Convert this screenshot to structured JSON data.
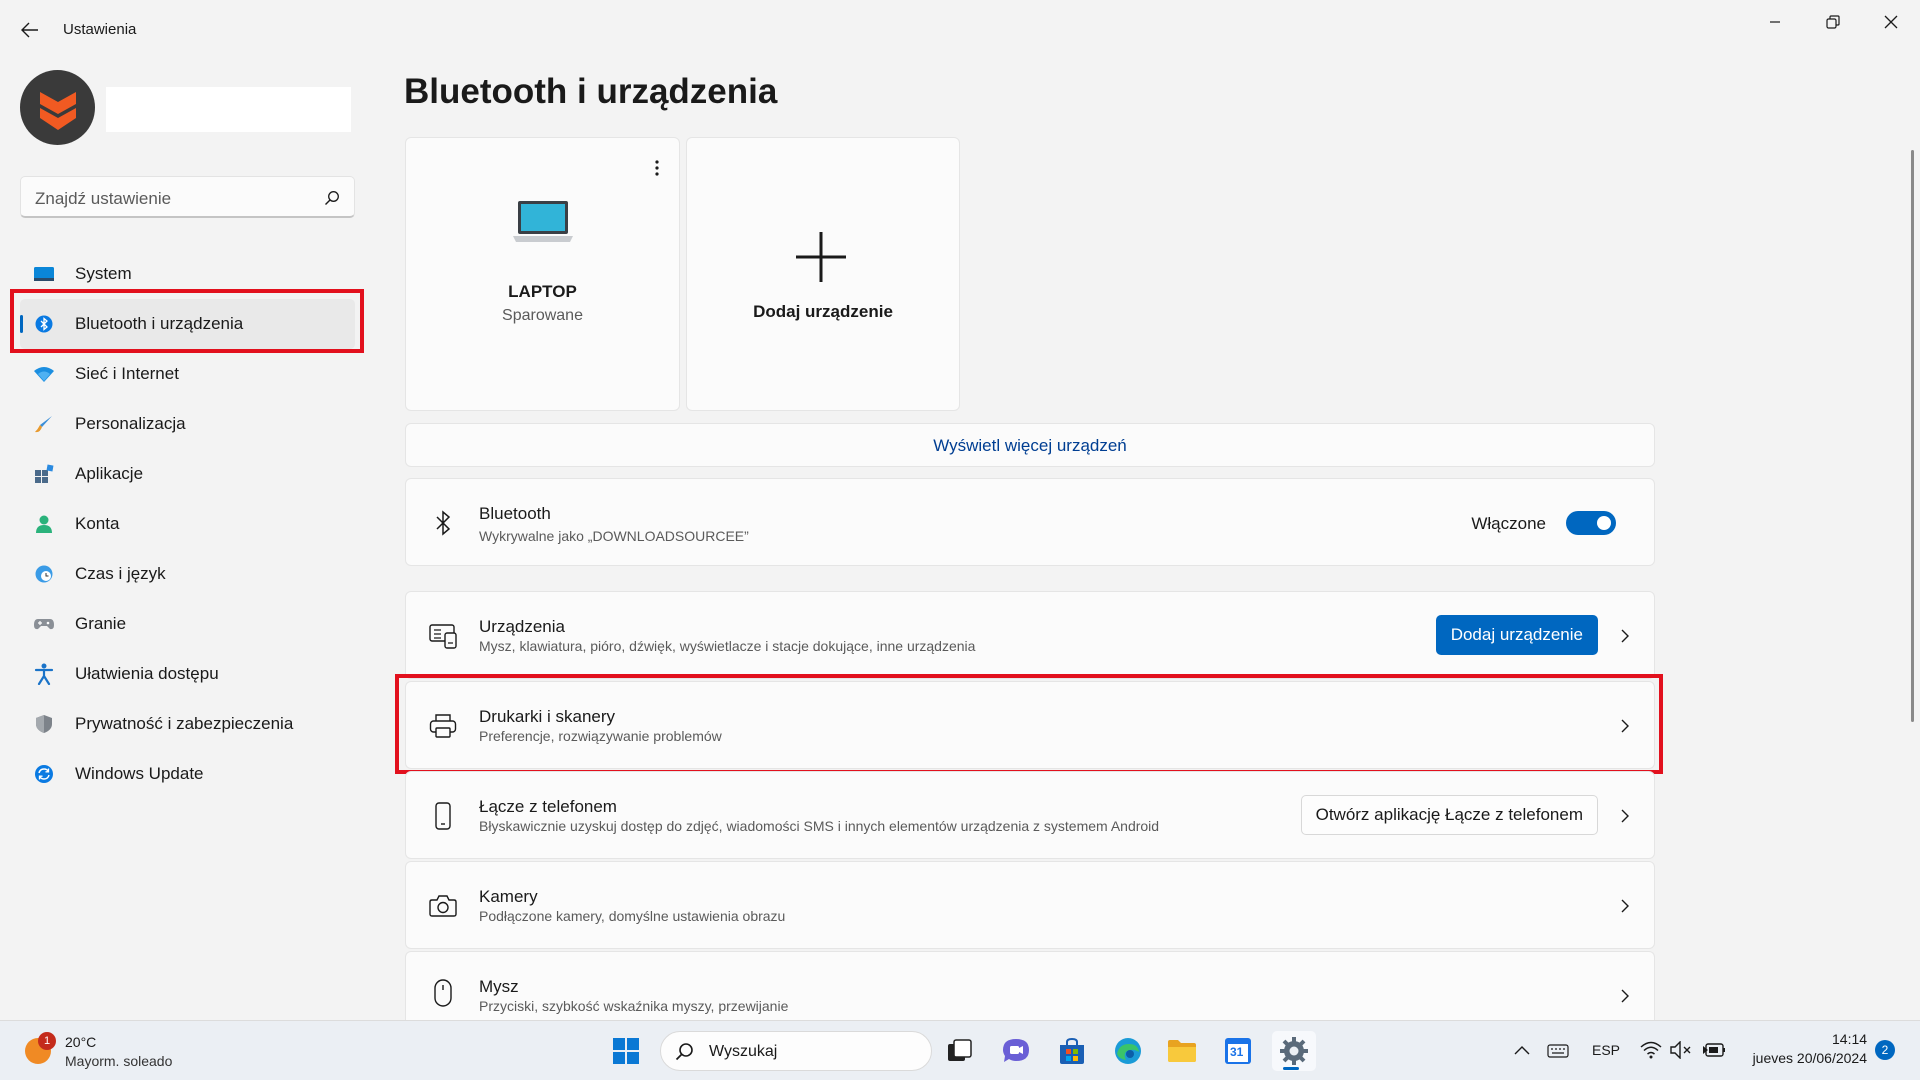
{
  "app": {
    "title": "Ustawienia"
  },
  "search": {
    "placeholder": "Znajdź ustawienie"
  },
  "sidebar": {
    "items": [
      {
        "label": "System",
        "icon": "monitor-icon"
      },
      {
        "label": "Bluetooth i urządzenia",
        "icon": "bluetooth-icon",
        "active": true
      },
      {
        "label": "Sieć i Internet",
        "icon": "wifi-icon"
      },
      {
        "label": "Personalizacja",
        "icon": "brush-icon"
      },
      {
        "label": "Aplikacje",
        "icon": "apps-icon"
      },
      {
        "label": "Konta",
        "icon": "person-icon"
      },
      {
        "label": "Czas i język",
        "icon": "globe-clock-icon"
      },
      {
        "label": "Granie",
        "icon": "gamepad-icon"
      },
      {
        "label": "Ułatwienia dostępu",
        "icon": "accessibility-icon"
      },
      {
        "label": "Prywatność i zabezpieczenia",
        "icon": "shield-icon"
      },
      {
        "label": "Windows Update",
        "icon": "update-icon"
      }
    ]
  },
  "main": {
    "title": "Bluetooth i urządzenia",
    "device_cards": [
      {
        "name": "LAPTOP",
        "status": "Sparowane"
      },
      {
        "name": "Dodaj urządzenie"
      }
    ],
    "more_devices_link": "Wyświetl więcej urządzeń",
    "bluetooth": {
      "title": "Bluetooth",
      "subtitle": "Wykrywalne jako „DOWNLOADSOURCEE”",
      "toggle_label": "Włączone",
      "toggle_on": true
    },
    "rows": [
      {
        "title": "Urządzenia",
        "subtitle": "Mysz, klawiatura, pióro, dźwięk, wyświetlacze i stacje dokujące, inne urządzenia",
        "button": "Dodaj urządzenie"
      },
      {
        "title": "Drukarki i skanery",
        "subtitle": "Preferencje, rozwiązywanie problemów"
      },
      {
        "title": "Łącze z telefonem",
        "subtitle": "Błyskawicznie uzyskuj dostęp do zdjęć, wiadomości SMS i innych elementów urządzenia z systemem Android",
        "button": "Otwórz aplikację Łącze z telefonem"
      },
      {
        "title": "Kamery",
        "subtitle": "Podłączone kamery, domyślne ustawienia obrazu"
      },
      {
        "title": "Mysz",
        "subtitle": "Przyciski, szybkość wskaźnika myszy, przewijanie"
      }
    ]
  },
  "taskbar": {
    "weather": {
      "temp": "20°C",
      "desc": "Mayorm. soleado",
      "badge": "1"
    },
    "search_label": "Wyszukaj",
    "calendar_day": "31",
    "tray": {
      "lang": "ESP",
      "time": "14:14",
      "date": "jueves 20/06/2024",
      "notifications": "2"
    }
  },
  "colors": {
    "accent": "#0067c0",
    "highlight": "#e2101d",
    "link": "#003e92"
  }
}
